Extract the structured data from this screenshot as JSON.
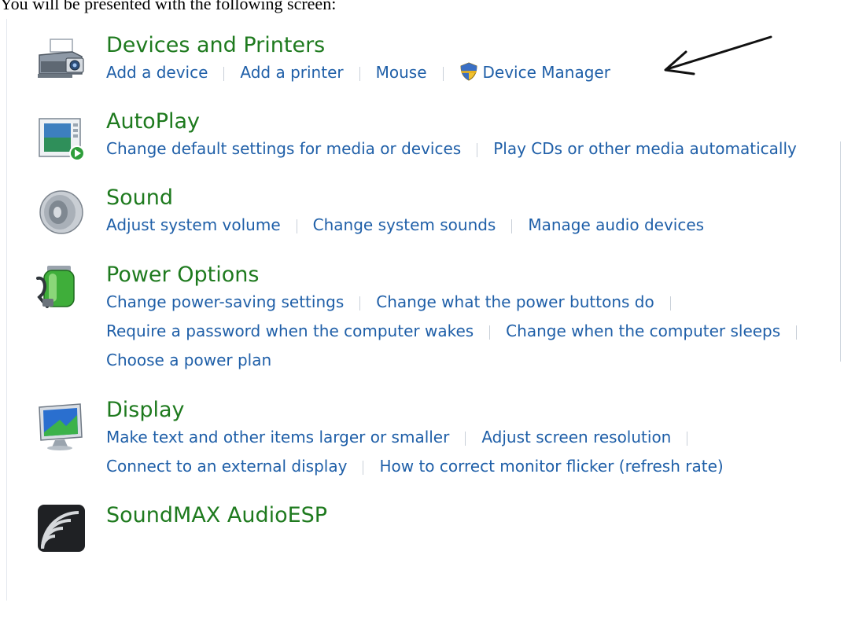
{
  "intro_text": "You will be presented with the following screen:",
  "categories": [
    {
      "title": "Devices and Printers",
      "icon": "devices-printers-icon",
      "rows": [
        [
          "Add a device",
          "Add a printer",
          "Mouse",
          "Device Manager"
        ]
      ]
    },
    {
      "title": "AutoPlay",
      "icon": "autoplay-icon",
      "rows": [
        [
          "Change default settings for media or devices",
          "Play CDs or other media automatically"
        ]
      ]
    },
    {
      "title": "Sound",
      "icon": "speaker-icon",
      "rows": [
        [
          "Adjust system volume",
          "Change system sounds",
          "Manage audio devices"
        ]
      ]
    },
    {
      "title": "Power Options",
      "icon": "battery-icon",
      "rows": [
        [
          "Change power-saving settings",
          "Change what the power buttons do"
        ],
        [
          "Require a password when the computer wakes",
          "Change when the computer sleeps"
        ],
        [
          "Choose a power plan"
        ]
      ]
    },
    {
      "title": "Display",
      "icon": "monitor-icon",
      "rows": [
        [
          "Make text and other items larger or smaller",
          "Adjust screen resolution"
        ],
        [
          "Connect to an external display",
          "How to correct monitor flicker (refresh rate)"
        ]
      ]
    },
    {
      "title": "SoundMAX AudioESP",
      "icon": "soundmax-icon",
      "rows": []
    }
  ],
  "colors": {
    "title_green": "#1e7a1e",
    "link_blue": "#1f5fa8",
    "separator": "#c8cfd8"
  }
}
